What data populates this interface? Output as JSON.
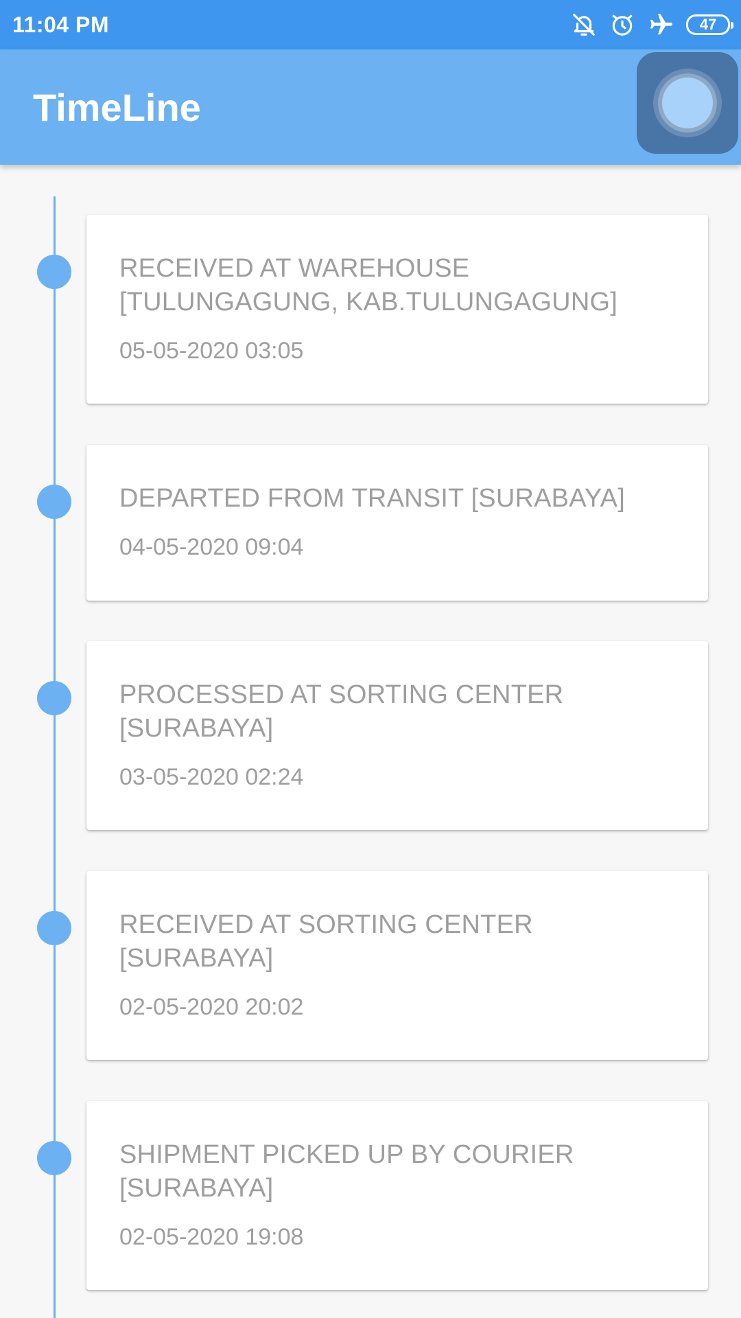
{
  "status_bar": {
    "time": "11:04 PM",
    "battery": "47",
    "icons": [
      "bell-off-icon",
      "alarm-icon",
      "airplane-icon",
      "battery-icon"
    ]
  },
  "app_bar": {
    "title": "TimeLine"
  },
  "colors": {
    "status_bar": "#3f96ee",
    "app_bar": "#6cb1f1",
    "timeline": "#6cb1f1",
    "text": "#9e9e9e",
    "card": "#ffffff"
  },
  "timeline": [
    {
      "title": "RECEIVED AT WAREHOUSE [TULUNGAGUNG, KAB.TULUNGAGUNG]",
      "date": "05-05-2020 03:05"
    },
    {
      "title": "DEPARTED FROM TRANSIT [SURABAYA]",
      "date": "04-05-2020 09:04"
    },
    {
      "title": "PROCESSED AT SORTING CENTER [SURABAYA]",
      "date": "03-05-2020 02:24"
    },
    {
      "title": "RECEIVED AT SORTING CENTER [SURABAYA]",
      "date": "02-05-2020 20:02"
    },
    {
      "title": "SHIPMENT PICKED UP BY COURIER [SURABAYA]",
      "date": "02-05-2020 19:08"
    }
  ]
}
